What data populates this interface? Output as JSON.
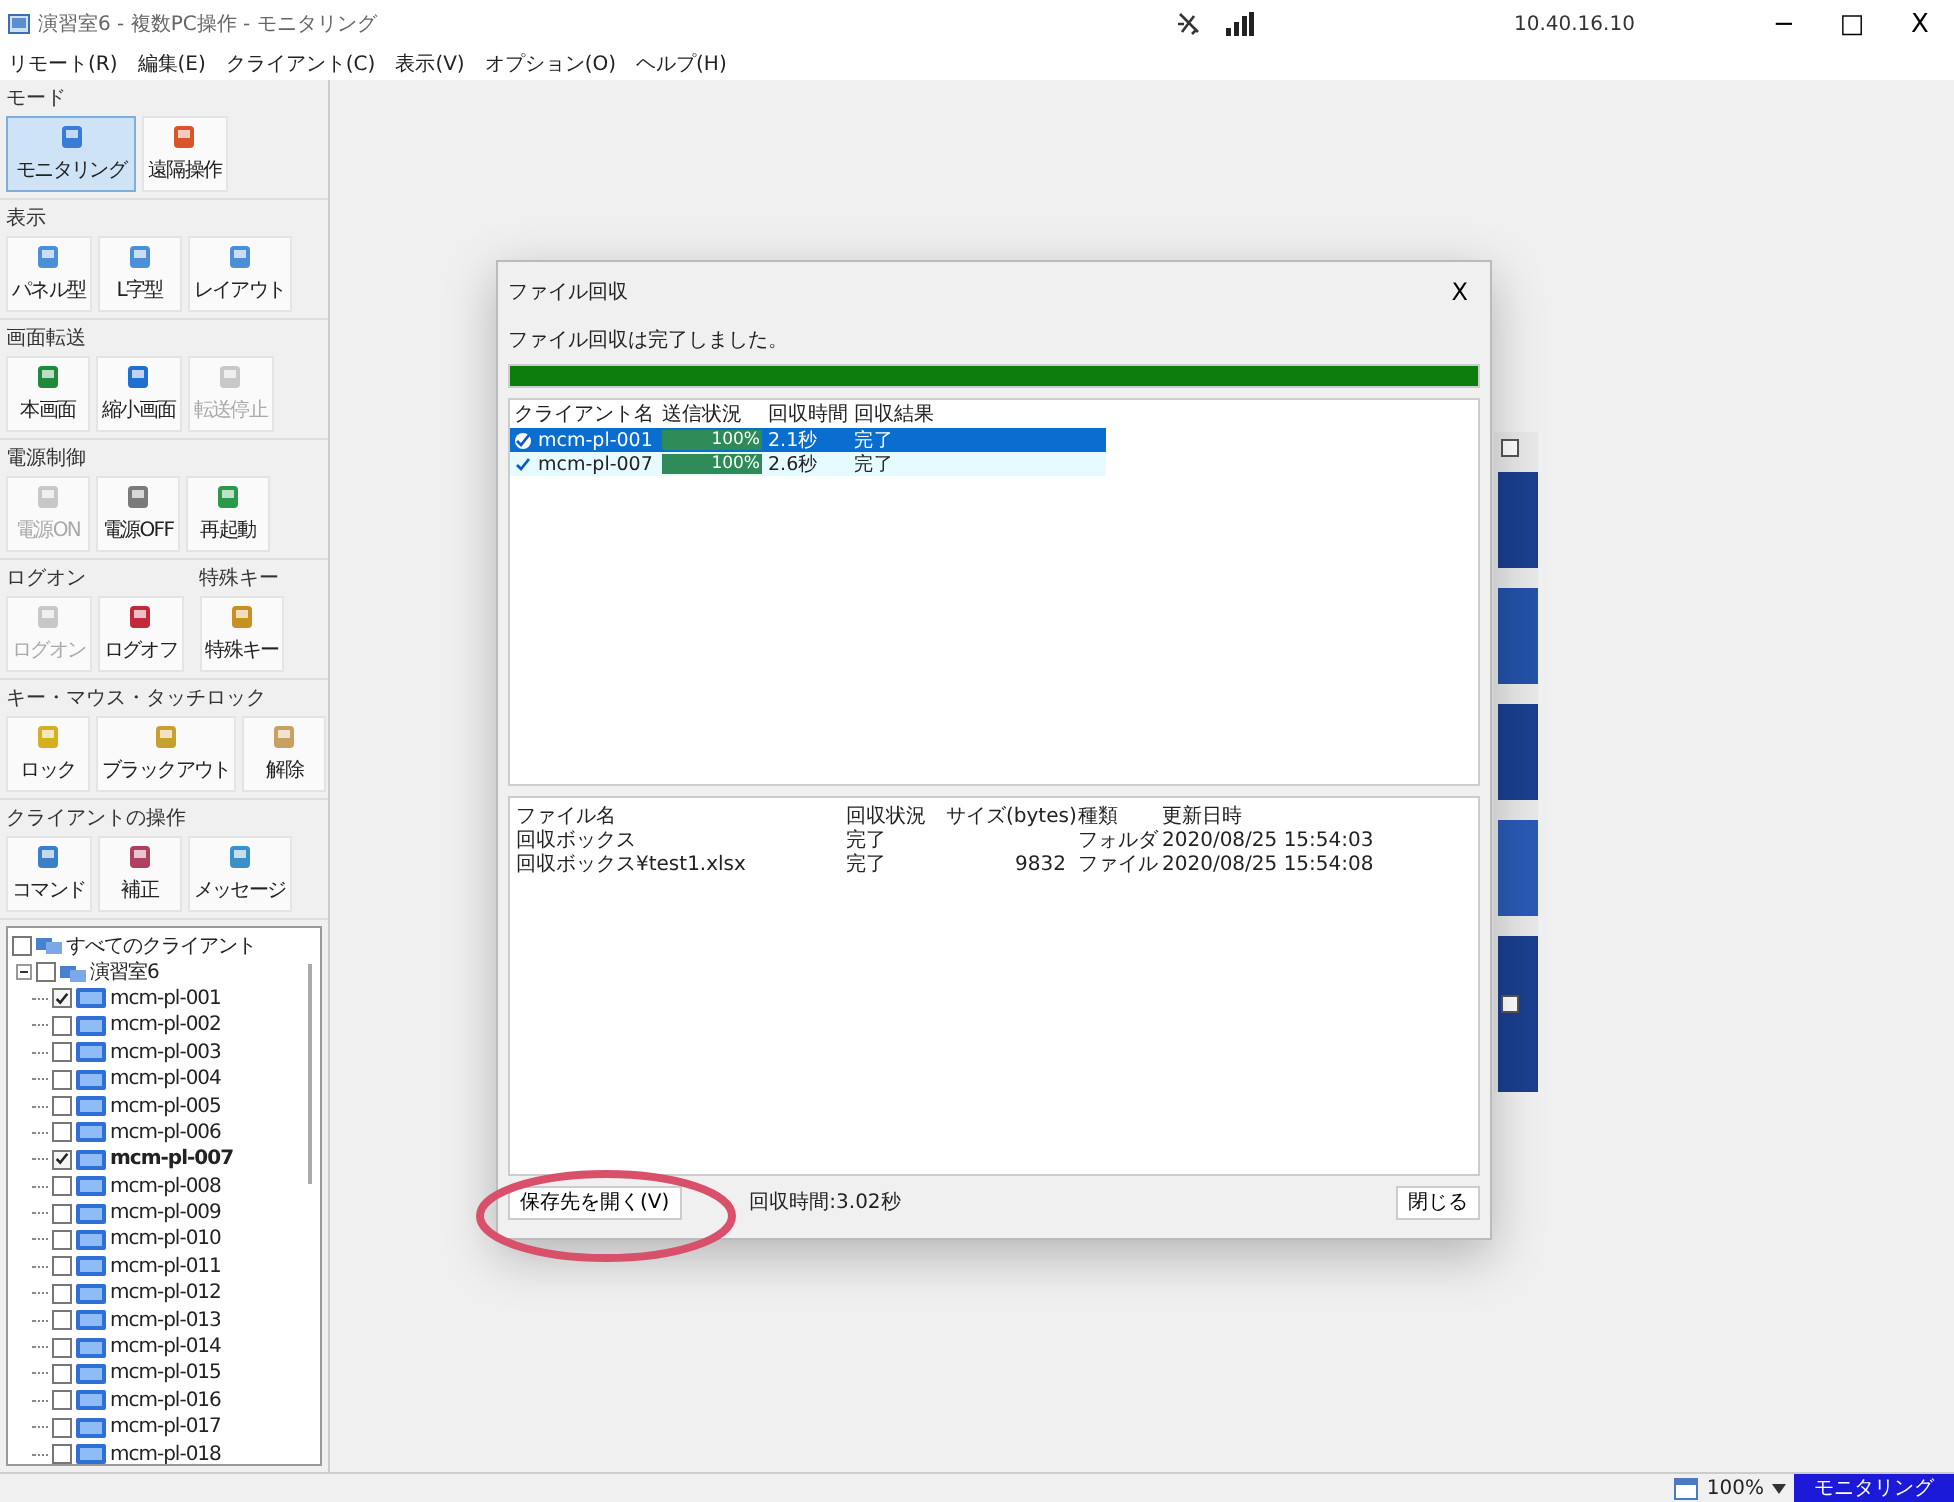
{
  "window": {
    "title": "演習室6 - 複数PC操作 - モニタリング",
    "ip": "10.40.16.10",
    "controls": [
      "−",
      "□",
      "X"
    ]
  },
  "menu": [
    "リモート(R)",
    "編集(E)",
    "クライアント(C)",
    "表示(V)",
    "オプション(O)",
    "ヘルプ(H)"
  ],
  "sidebar": {
    "sections": [
      {
        "groups": [
          {
            "title": "モード",
            "buttons": [
              {
                "label": "モニタリング",
                "selected": true,
                "disabled": false
              },
              {
                "label": "遠隔操作",
                "selected": false,
                "disabled": false
              }
            ]
          }
        ]
      },
      {
        "groups": [
          {
            "title": "表示",
            "buttons": [
              {
                "label": "パネル型",
                "selected": false,
                "disabled": false
              },
              {
                "label": "L字型",
                "selected": false,
                "disabled": false
              },
              {
                "label": "レイアウト",
                "selected": false,
                "disabled": false
              }
            ]
          }
        ]
      },
      {
        "groups": [
          {
            "title": "画面転送",
            "buttons": [
              {
                "label": "本画面",
                "selected": false,
                "disabled": false
              },
              {
                "label": "縮小画面",
                "selected": false,
                "disabled": false
              },
              {
                "label": "転送停止",
                "selected": false,
                "disabled": true
              }
            ]
          }
        ]
      },
      {
        "groups": [
          {
            "title": "電源制御",
            "buttons": [
              {
                "label": "電源ON",
                "selected": false,
                "disabled": true
              },
              {
                "label": "電源OFF",
                "selected": false,
                "disabled": false
              },
              {
                "label": "再起動",
                "selected": false,
                "disabled": false
              }
            ]
          }
        ]
      },
      {
        "groups": [
          {
            "title": "ログオン",
            "buttons": [
              {
                "label": "ログオン",
                "selected": false,
                "disabled": true
              },
              {
                "label": "ログオフ",
                "selected": false,
                "disabled": false
              }
            ]
          },
          {
            "title": "特殊キー",
            "buttons": [
              {
                "label": "特殊キー",
                "selected": false,
                "disabled": false
              }
            ]
          }
        ]
      },
      {
        "groups": [
          {
            "title": "キー・マウス・タッチロック",
            "buttons": [
              {
                "label": "ロック",
                "selected": false,
                "disabled": false
              },
              {
                "label": "ブラックアウト",
                "selected": false,
                "disabled": false
              },
              {
                "label": "解除",
                "selected": false,
                "disabled": false
              }
            ]
          }
        ]
      },
      {
        "groups": [
          {
            "title": "クライアントの操作",
            "buttons": [
              {
                "label": "コマンド",
                "selected": false,
                "disabled": false
              },
              {
                "label": "補正",
                "selected": false,
                "disabled": false
              },
              {
                "label": "メッセージ",
                "selected": false,
                "disabled": false
              }
            ]
          }
        ]
      }
    ]
  },
  "tree": {
    "label": "すべてのクライアント",
    "checked": false,
    "children": [
      {
        "label": "演習室6",
        "checked": false,
        "expanded": true,
        "children": [
          {
            "label": "mcm-pl-001",
            "checked": true
          },
          {
            "label": "mcm-pl-002",
            "checked": false
          },
          {
            "label": "mcm-pl-003",
            "checked": false
          },
          {
            "label": "mcm-pl-004",
            "checked": false
          },
          {
            "label": "mcm-pl-005",
            "checked": false
          },
          {
            "label": "mcm-pl-006",
            "checked": false
          },
          {
            "label": "mcm-pl-007",
            "checked": true
          },
          {
            "label": "mcm-pl-008",
            "checked": false
          },
          {
            "label": "mcm-pl-009",
            "checked": false
          },
          {
            "label": "mcm-pl-010",
            "checked": false
          },
          {
            "label": "mcm-pl-011",
            "checked": false
          },
          {
            "label": "mcm-pl-012",
            "checked": false
          },
          {
            "label": "mcm-pl-013",
            "checked": false
          },
          {
            "label": "mcm-pl-014",
            "checked": false
          },
          {
            "label": "mcm-pl-015",
            "checked": false
          },
          {
            "label": "mcm-pl-016",
            "checked": false
          },
          {
            "label": "mcm-pl-017",
            "checked": false
          },
          {
            "label": "mcm-pl-018",
            "checked": false
          }
        ]
      }
    ]
  },
  "dialog": {
    "title": "ファイル回収",
    "close": "X",
    "message": "ファイル回収は完了しました。",
    "progress": {
      "level": 1
    },
    "clients": {
      "columns": [
        "クライアント名",
        "送信状況",
        "回収時間",
        "回収結果"
      ],
      "rows": [
        {
          "name": "mcm-pl-001",
          "level": 1,
          "reading": "100%",
          "time": "2.1秒",
          "result": "完了",
          "selected": true
        },
        {
          "name": "mcm-pl-007",
          "level": 1,
          "reading": "100%",
          "time": "2.6秒",
          "result": "完了",
          "selected": false
        }
      ]
    },
    "files": {
      "columns": [
        "ファイル名",
        "回収状況",
        "サイズ(bytes)",
        "種類",
        "更新日時"
      ],
      "rows": [
        [
          "回収ボックス",
          "完了",
          "",
          "フォルダ",
          "2020/08/25 15:54:03"
        ],
        [
          "回収ボックス¥test1.xlsx",
          "完了",
          "9832",
          "ファイル",
          "2020/08/25 15:54:08"
        ]
      ]
    },
    "open_button": "保存先を開く(V)",
    "elapsed": "回収時間:3.02秒",
    "close_button": "閉じる"
  },
  "status_bar": {
    "zoom": "100%",
    "mode": "モニタリング"
  }
}
